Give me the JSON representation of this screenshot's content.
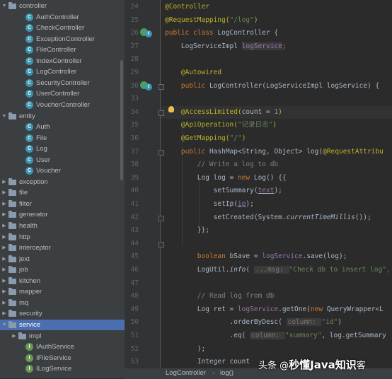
{
  "tree": {
    "items": [
      {
        "label": "controller",
        "kind": "folder",
        "indent": 0,
        "expanded": true
      },
      {
        "label": "AuthController",
        "kind": "class",
        "indent": 2
      },
      {
        "label": "CheckController",
        "kind": "class",
        "indent": 2
      },
      {
        "label": "ExceptionController",
        "kind": "class",
        "indent": 2
      },
      {
        "label": "FileController",
        "kind": "class",
        "indent": 2
      },
      {
        "label": "IndexController",
        "kind": "class",
        "indent": 2
      },
      {
        "label": "LogController",
        "kind": "class",
        "indent": 2
      },
      {
        "label": "SecurityController",
        "kind": "class",
        "indent": 2
      },
      {
        "label": "UserController",
        "kind": "class",
        "indent": 2
      },
      {
        "label": "VoucherController",
        "kind": "class",
        "indent": 2
      },
      {
        "label": "entity",
        "kind": "folder",
        "indent": 0,
        "expanded": true
      },
      {
        "label": "Auth",
        "kind": "class",
        "indent": 2
      },
      {
        "label": "File",
        "kind": "class",
        "indent": 2
      },
      {
        "label": "Log",
        "kind": "class",
        "indent": 2
      },
      {
        "label": "User",
        "kind": "class",
        "indent": 2
      },
      {
        "label": "Voucher",
        "kind": "class",
        "indent": 2
      },
      {
        "label": "exception",
        "kind": "folder",
        "indent": 0,
        "expanded": false
      },
      {
        "label": "file",
        "kind": "folder",
        "indent": 0,
        "expanded": false
      },
      {
        "label": "filter",
        "kind": "folder",
        "indent": 0,
        "expanded": false
      },
      {
        "label": "generator",
        "kind": "folder",
        "indent": 0,
        "expanded": false
      },
      {
        "label": "health",
        "kind": "folder",
        "indent": 0,
        "expanded": false
      },
      {
        "label": "http",
        "kind": "folder",
        "indent": 0,
        "expanded": false
      },
      {
        "label": "interceptor",
        "kind": "folder",
        "indent": 0,
        "expanded": false
      },
      {
        "label": "jext",
        "kind": "folder",
        "indent": 0,
        "expanded": false
      },
      {
        "label": "job",
        "kind": "folder",
        "indent": 0,
        "expanded": false
      },
      {
        "label": "kitchen",
        "kind": "folder",
        "indent": 0,
        "expanded": false
      },
      {
        "label": "mapper",
        "kind": "folder",
        "indent": 0,
        "expanded": false
      },
      {
        "label": "mq",
        "kind": "folder",
        "indent": 0,
        "expanded": false
      },
      {
        "label": "security",
        "kind": "folder",
        "indent": 0,
        "expanded": false
      },
      {
        "label": "service",
        "kind": "folder",
        "indent": 0,
        "expanded": true,
        "selected": true
      },
      {
        "label": "impl",
        "kind": "folder",
        "indent": 1,
        "expanded": false
      },
      {
        "label": "IAuthService",
        "kind": "interface",
        "indent": 2
      },
      {
        "label": "IFileService",
        "kind": "interface",
        "indent": 2
      },
      {
        "label": "ILogService",
        "kind": "interface",
        "indent": 2
      }
    ]
  },
  "editor": {
    "line_numbers": [
      "24",
      "25",
      "26",
      "27",
      "28",
      "29",
      "30",
      "33",
      "34",
      "35",
      "36",
      "37",
      "38",
      "39",
      "40",
      "41",
      "42",
      "43",
      "44",
      "45",
      "46",
      "47",
      "48",
      "49",
      "50",
      "51",
      "52",
      "53"
    ],
    "lines": [
      [
        {
          "t": "@Controller",
          "c": "ann"
        }
      ],
      [
        {
          "t": "@RequestMapping(",
          "c": "ann"
        },
        {
          "t": "\"/log\"",
          "c": "str"
        },
        {
          "t": ")",
          "c": "ann"
        }
      ],
      [
        {
          "t": "public class ",
          "c": "kw"
        },
        {
          "t": "LogController {",
          "c": ""
        }
      ],
      [
        {
          "t": "    LogServiceImpl ",
          "c": ""
        },
        {
          "t": "logService",
          "c": "fld unused"
        },
        {
          "t": ";",
          "c": "kw"
        }
      ],
      [],
      [
        {
          "t": "    @Autowired",
          "c": "ann"
        }
      ],
      [
        {
          "t": "    ",
          "c": ""
        },
        {
          "t": "public ",
          "c": "kw"
        },
        {
          "t": "LogController(LogServiceImpl logService) { ",
          "c": ""
        }
      ],
      [],
      [
        {
          "t": "    @AccessLimited(",
          "c": "ann"
        },
        {
          "t": "count = ",
          "c": ""
        },
        {
          "t": "1",
          "c": "num"
        },
        {
          "t": ")",
          "c": "ann"
        }
      ],
      [
        {
          "t": "    @ApiOperation(",
          "c": "ann"
        },
        {
          "t": "\"记录日志\"",
          "c": "str"
        },
        {
          "t": ")",
          "c": "ann"
        }
      ],
      [
        {
          "t": "    @GetMapping(",
          "c": "ann"
        },
        {
          "t": "\"/\"",
          "c": "str"
        },
        {
          "t": ")",
          "c": "ann"
        }
      ],
      [
        {
          "t": "    ",
          "c": ""
        },
        {
          "t": "public ",
          "c": "kw"
        },
        {
          "t": "HashMap<String, Object> log(",
          "c": ""
        },
        {
          "t": "@RequestAttribu",
          "c": "ann"
        }
      ],
      [
        {
          "t": "        // Write a log to db",
          "c": "cmt"
        }
      ],
      [
        {
          "t": "        Log log = ",
          "c": ""
        },
        {
          "t": "new ",
          "c": "kw"
        },
        {
          "t": "Log() {{",
          "c": ""
        }
      ],
      [
        {
          "t": "            setSummary(",
          "c": ""
        },
        {
          "t": "text",
          "c": "fld ul"
        },
        {
          "t": ");",
          "c": ""
        }
      ],
      [
        {
          "t": "            setIp(",
          "c": ""
        },
        {
          "t": "ip",
          "c": "fld ul"
        },
        {
          "t": ");",
          "c": ""
        }
      ],
      [
        {
          "t": "            setCreated(System.",
          "c": ""
        },
        {
          "t": "currentTimeMillis",
          "c": "ital"
        },
        {
          "t": "());",
          "c": ""
        }
      ],
      [
        {
          "t": "        }};",
          "c": ""
        }
      ],
      [],
      [
        {
          "t": "        ",
          "c": ""
        },
        {
          "t": "boolean ",
          "c": "kw"
        },
        {
          "t": "bSave = ",
          "c": ""
        },
        {
          "t": "logService",
          "c": "fld"
        },
        {
          "t": ".save(log);",
          "c": ""
        }
      ],
      [
        {
          "t": "        LogUtil.",
          "c": ""
        },
        {
          "t": "info",
          "c": "ital"
        },
        {
          "t": "( ",
          "c": ""
        },
        {
          "t": "...msg: ",
          "c": "hint"
        },
        {
          "t": "\"Check db to insert log\",",
          "c": "str"
        }
      ],
      [],
      [
        {
          "t": "        // Read log from db",
          "c": "cmt"
        }
      ],
      [
        {
          "t": "        Log ret = ",
          "c": ""
        },
        {
          "t": "logService",
          "c": "fld"
        },
        {
          "t": ".getOne(",
          "c": ""
        },
        {
          "t": "new ",
          "c": "kw"
        },
        {
          "t": "QueryWrapper<L",
          "c": ""
        }
      ],
      [
        {
          "t": "                .orderByDesc( ",
          "c": ""
        },
        {
          "t": "column: ",
          "c": "hint"
        },
        {
          "t": "\"id\"",
          "c": "str"
        },
        {
          "t": ")",
          "c": ""
        }
      ],
      [
        {
          "t": "                .eq( ",
          "c": ""
        },
        {
          "t": "column: ",
          "c": "hint"
        },
        {
          "t": "\"summary\"",
          "c": "str"
        },
        {
          "t": ", log.getSummary",
          "c": ""
        }
      ],
      [
        {
          "t": "        );",
          "c": ""
        }
      ],
      [
        {
          "t": "        Integer count ",
          "c": ""
        }
      ]
    ]
  },
  "breadcrumb": {
    "class_name": "LogController",
    "method_name": "log()"
  },
  "watermark": {
    "prefix": "头条 @",
    "bold": "秒懂Java知识",
    "suffix": "客"
  }
}
